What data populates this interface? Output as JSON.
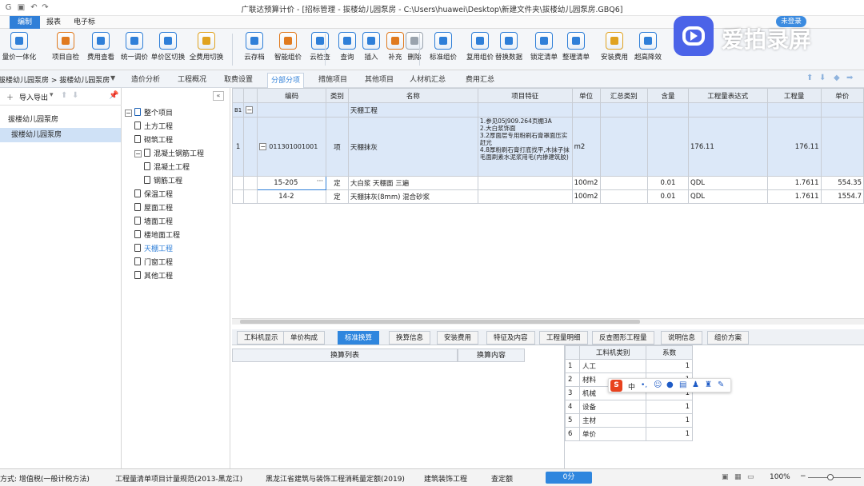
{
  "window": {
    "title": "广联达预算计价 - [招标管理 - 拔楼幼儿园泵房 - C:\\Users\\huawei\\Desktop\\新建文件夹\\拔楼幼儿园泵房.GBQ6]",
    "vip_label": "未登录"
  },
  "menu": [
    "编制",
    "报表",
    "电子标"
  ],
  "ribbon": [
    {
      "label": "量价一体化",
      "color": "#2f7fd8"
    },
    {
      "label": "项目自检",
      "color": "#e07a1f"
    },
    {
      "label": "费用查看",
      "color": "#2f7fd8"
    },
    {
      "label": "统一调价",
      "color": "#2f7fd8"
    },
    {
      "label": "单价区切换",
      "color": "#2f7fd8"
    },
    {
      "label": "全费用切换",
      "color": "#e0a21f"
    },
    {
      "label": "云存档",
      "color": "#2f7fd8"
    },
    {
      "label": "智能组价",
      "color": "#e07a1f"
    },
    {
      "label": "云检查",
      "color": "#2f7fd8"
    },
    {
      "label": "查询",
      "color": "#2f7fd8"
    },
    {
      "label": "插入",
      "color": "#2f7fd8"
    },
    {
      "label": "补充",
      "color": "#e07a1f"
    },
    {
      "label": "删除",
      "color": "#9aa3ad"
    },
    {
      "label": "标准组价",
      "color": "#2f7fd8"
    },
    {
      "label": "复用组价",
      "color": "#2f7fd8"
    },
    {
      "label": "替换数据",
      "color": "#2f7fd8"
    },
    {
      "label": "锁定清单",
      "color": "#2f7fd8"
    },
    {
      "label": "整理清单",
      "color": "#2f7fd8"
    },
    {
      "label": "安装费用",
      "color": "#e0a21f"
    },
    {
      "label": "超高降效",
      "color": "#2f7fd8"
    }
  ],
  "project": {
    "name": "拔楼幼儿园泵房",
    "import_export": "导入导出",
    "tree_root": "拔楼幼儿园泵房",
    "selected": "拔楼幼儿园泵房"
  },
  "nav_tabs": [
    "造价分析",
    "工程概况",
    "取费设置",
    "分部分项",
    "措施项目",
    "其他项目",
    "人材机汇总",
    "费用汇总"
  ],
  "tree": {
    "root": "整个项目",
    "items": [
      {
        "label": "土方工程",
        "level": 1
      },
      {
        "label": "砌筑工程",
        "level": 1
      },
      {
        "label": "混凝土钢筋工程",
        "level": 1,
        "toggle": "−"
      },
      {
        "label": "混凝土工程",
        "level": 2
      },
      {
        "label": "钢筋工程",
        "level": 2
      },
      {
        "label": "保温工程",
        "level": 1
      },
      {
        "label": "屋面工程",
        "level": 1
      },
      {
        "label": "墙面工程",
        "level": 1
      },
      {
        "label": "楼地面工程",
        "level": 1
      },
      {
        "label": "天棚工程",
        "level": 1,
        "selected": true
      },
      {
        "label": "门窗工程",
        "level": 1
      },
      {
        "label": "其他工程",
        "level": 1
      }
    ]
  },
  "grid": {
    "headers": [
      "编码",
      "类别",
      "名称",
      "项目特征",
      "单位",
      "汇总类别",
      "含量",
      "工程量表达式",
      "工程量",
      "单价"
    ],
    "group": {
      "idx": "B1",
      "toggle": "−",
      "name": "天棚工程"
    },
    "rows": [
      {
        "no": "1",
        "code": "011301001001",
        "type": "项",
        "name": "天棚抹灰",
        "feature": "1.参见05J909.264页棚3A\n2.大白浆饰面\n3.2厚面层专用粉刷石膏罩面压实赶光\n4.8厚粉刷石膏打底找平,木抹子抹毛面刷素水泥浆用毛(内掺建筑胶)",
        "unit": "m2",
        "sum": "",
        "content": "",
        "expr": "176.11",
        "qty": "176.11",
        "price": ""
      },
      {
        "no": "",
        "code": "15-205",
        "type": "定",
        "name": "大白浆 天棚面 三遍",
        "feature": "",
        "unit": "100m2",
        "sum": "",
        "content": "0.01",
        "expr": "QDL",
        "qty": "1.7611",
        "price": "554.35"
      },
      {
        "no": "",
        "code": "14-2",
        "type": "定",
        "name": "天棚抹灰(8mm) 混合砂浆",
        "feature": "",
        "unit": "100m2",
        "sum": "",
        "content": "0.01",
        "expr": "QDL",
        "qty": "1.7611",
        "price": "1554.7"
      }
    ]
  },
  "bottom_tabs": [
    "工料机显示",
    "单价构成",
    "标准换算",
    "换算信息",
    "安装费用",
    "特征及内容",
    "工程量明细",
    "反查图形工程量",
    "说明信息",
    "组价方案"
  ],
  "conv": {
    "col1": "换算列表",
    "col2": "换算内容"
  },
  "coef": {
    "col1": "工料机类别",
    "col2": "系数",
    "rows": [
      {
        "n": "1",
        "type": "人工",
        "v": "1"
      },
      {
        "n": "2",
        "type": "材料",
        "v": "1"
      },
      {
        "n": "3",
        "type": "机械",
        "v": "1"
      },
      {
        "n": "4",
        "type": "设备",
        "v": "1"
      },
      {
        "n": "5",
        "type": "主材",
        "v": "1"
      },
      {
        "n": "6",
        "type": "单价",
        "v": "1"
      }
    ]
  },
  "ime": {
    "logo": "S",
    "lang": "中"
  },
  "status": {
    "tax": "方式: 增值税(一般计税方法)",
    "spec": "工程量清单项目计量规范(2013-黑龙江)",
    "quota": "黑龙江省建筑与装饰工程消耗量定额(2019)",
    "major": "建筑装饰工程",
    "view": "查定额",
    "score": "0分",
    "zoom": "100%"
  },
  "watermark": "爱拍录屏"
}
